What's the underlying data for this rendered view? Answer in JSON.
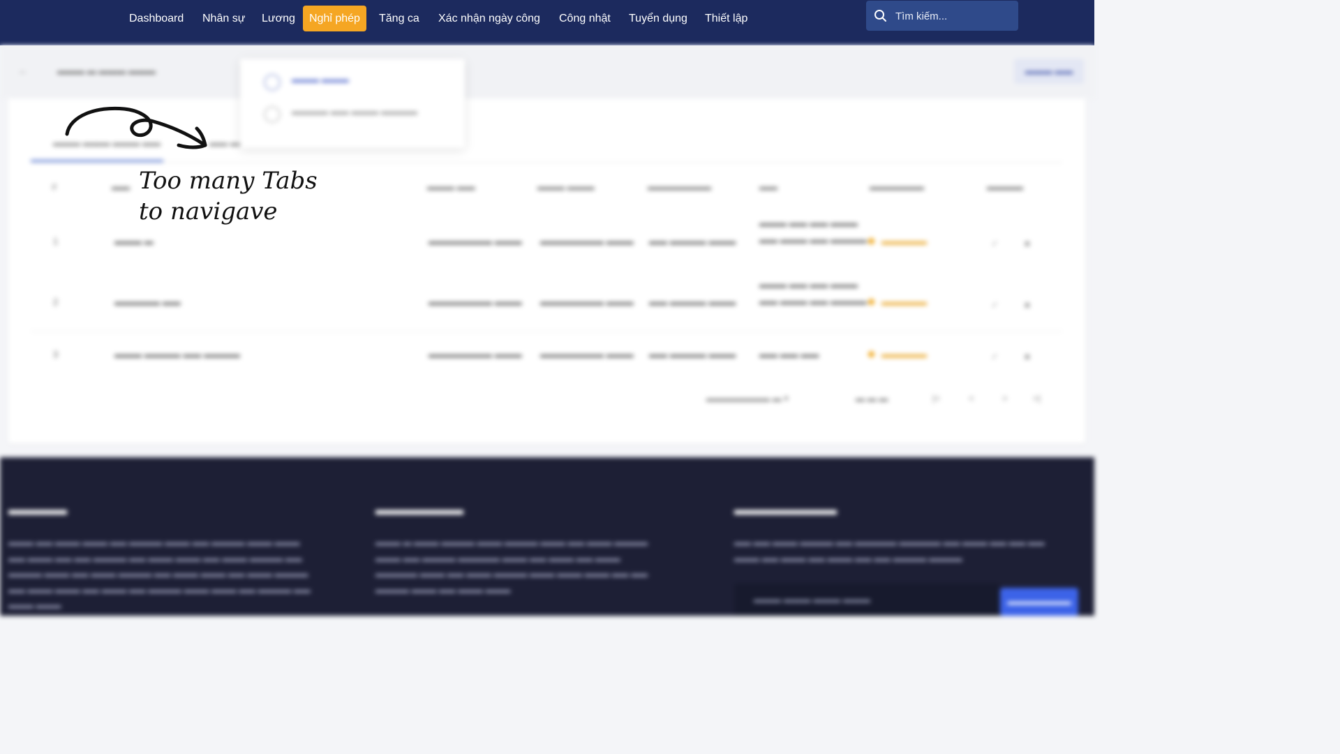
{
  "nav": {
    "items": [
      {
        "label": "Dashboard"
      },
      {
        "label": "Nhân sự"
      },
      {
        "label": "Lương"
      },
      {
        "label": "Nghỉ phép"
      },
      {
        "label": "Tăng ca"
      },
      {
        "label": "Xác nhận ngày công"
      },
      {
        "label": "Công nhật"
      },
      {
        "label": "Tuyển dụng"
      },
      {
        "label": "Thiết lập"
      }
    ],
    "active_item": "Nghỉ phép",
    "search": {
      "placeholder": "Tìm kiếm..."
    },
    "colors": {
      "background": "#1c2a5e",
      "active": "#f5a623",
      "search_bg": "#2f4a8a"
    }
  },
  "annotation": {
    "line1": "Too many Tabs",
    "line2": "to navigave"
  },
  "page": {
    "blurred": true,
    "dropdown_items": [
      {
        "icon": "leave-icon"
      },
      {
        "icon": "history-icon"
      }
    ],
    "table": {
      "rows": [
        {
          "index": "1"
        },
        {
          "index": "2"
        },
        {
          "index": "3"
        }
      ],
      "status_color": "#f0a81d"
    }
  },
  "footer": {
    "colors": {
      "background": "#1d1f35",
      "button": "#3c63e8"
    }
  }
}
